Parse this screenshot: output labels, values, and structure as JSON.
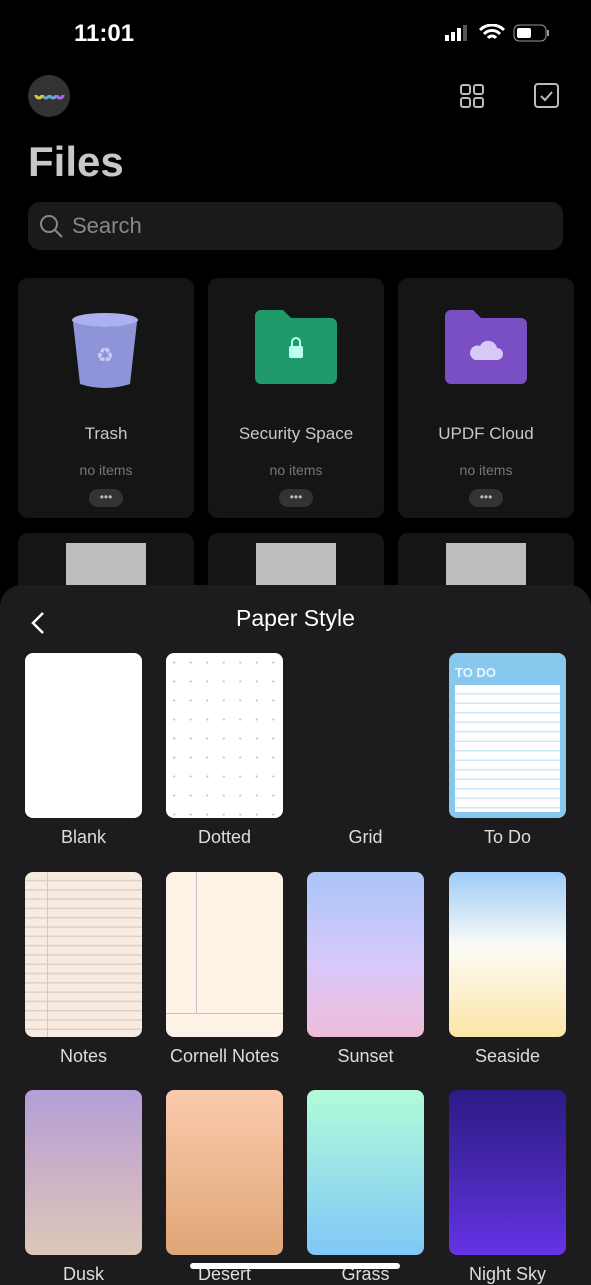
{
  "status_bar": {
    "time": "11:01"
  },
  "header": {
    "title": "Files",
    "search_placeholder": "Search"
  },
  "folders": [
    {
      "name": "Trash",
      "count": "no items",
      "icon": "trash-icon",
      "color": "#8f94d8"
    },
    {
      "name": "Security Space",
      "count": "no items",
      "icon": "lock-folder-icon",
      "color": "#1f9a6a"
    },
    {
      "name": "UPDF Cloud",
      "count": "no items",
      "icon": "cloud-folder-icon",
      "color": "#7a4fc4"
    }
  ],
  "more_label": "•••",
  "sheet": {
    "title": "Paper Style",
    "styles": [
      {
        "label": "Blank"
      },
      {
        "label": "Dotted"
      },
      {
        "label": "Grid"
      },
      {
        "label": "To Do",
        "header": "TO DO"
      },
      {
        "label": "Notes"
      },
      {
        "label": "Cornell Notes"
      },
      {
        "label": "Sunset"
      },
      {
        "label": "Seaside"
      },
      {
        "label": "Dusk"
      },
      {
        "label": "Desert"
      },
      {
        "label": "Grass"
      },
      {
        "label": "Night Sky"
      }
    ]
  }
}
